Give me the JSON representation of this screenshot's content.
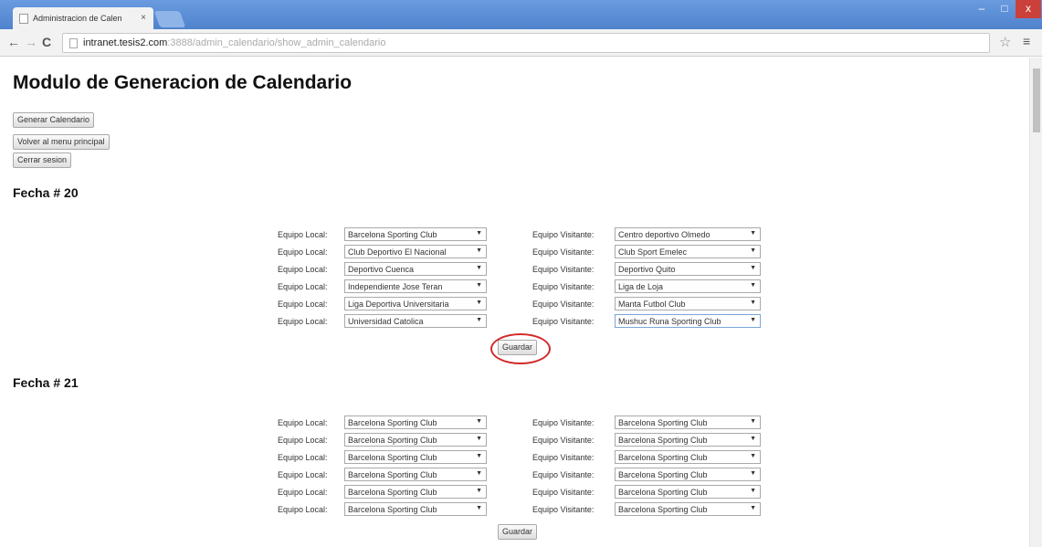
{
  "browser": {
    "tab_title": "Administracion de Calen",
    "tab_close": "×",
    "url_host": "intranet.tesis2.com",
    "url_rest": ":3888/admin_calendario/show_admin_calendario",
    "back": "←",
    "forward": "→",
    "reload": "C",
    "star": "☆",
    "menu": "≡",
    "minimize": "–",
    "maximize": "□",
    "close": "x"
  },
  "page": {
    "title": "Modulo de Generacion de Calendario",
    "buttons": {
      "generate": "Generar Calendario",
      "back_menu": "Volver al menu principal",
      "logout": "Cerrar sesion"
    },
    "local_label": "Equipo Local:",
    "visit_label": "Equipo Visitante:",
    "save_label": "Guardar",
    "dropdown_arrow": "▼"
  },
  "rounds": [
    {
      "title": "Fecha # 20",
      "matches": [
        {
          "local": "Barcelona Sporting Club",
          "visitante": "Centro deportivo Olmedo"
        },
        {
          "local": "Club Deportivo El Nacional",
          "visitante": "Club Sport Emelec"
        },
        {
          "local": "Deportivo Cuenca",
          "visitante": "Deportivo Quito"
        },
        {
          "local": "Independiente Jose Teran",
          "visitante": "Liga de Loja"
        },
        {
          "local": "Liga Deportiva Universitaria",
          "visitante": "Manta Futbol Club"
        },
        {
          "local": "Universidad Catolica",
          "visitante": "Mushuc Runa Sporting Club"
        }
      ]
    },
    {
      "title": "Fecha # 21",
      "matches": [
        {
          "local": "Barcelona Sporting Club",
          "visitante": "Barcelona Sporting Club"
        },
        {
          "local": "Barcelona Sporting Club",
          "visitante": "Barcelona Sporting Club"
        },
        {
          "local": "Barcelona Sporting Club",
          "visitante": "Barcelona Sporting Club"
        },
        {
          "local": "Barcelona Sporting Club",
          "visitante": "Barcelona Sporting Club"
        },
        {
          "local": "Barcelona Sporting Club",
          "visitante": "Barcelona Sporting Club"
        },
        {
          "local": "Barcelona Sporting Club",
          "visitante": "Barcelona Sporting Club"
        }
      ]
    }
  ],
  "colors": {
    "titlebar": "#4f83cc",
    "highlight": "#d22a2a"
  }
}
